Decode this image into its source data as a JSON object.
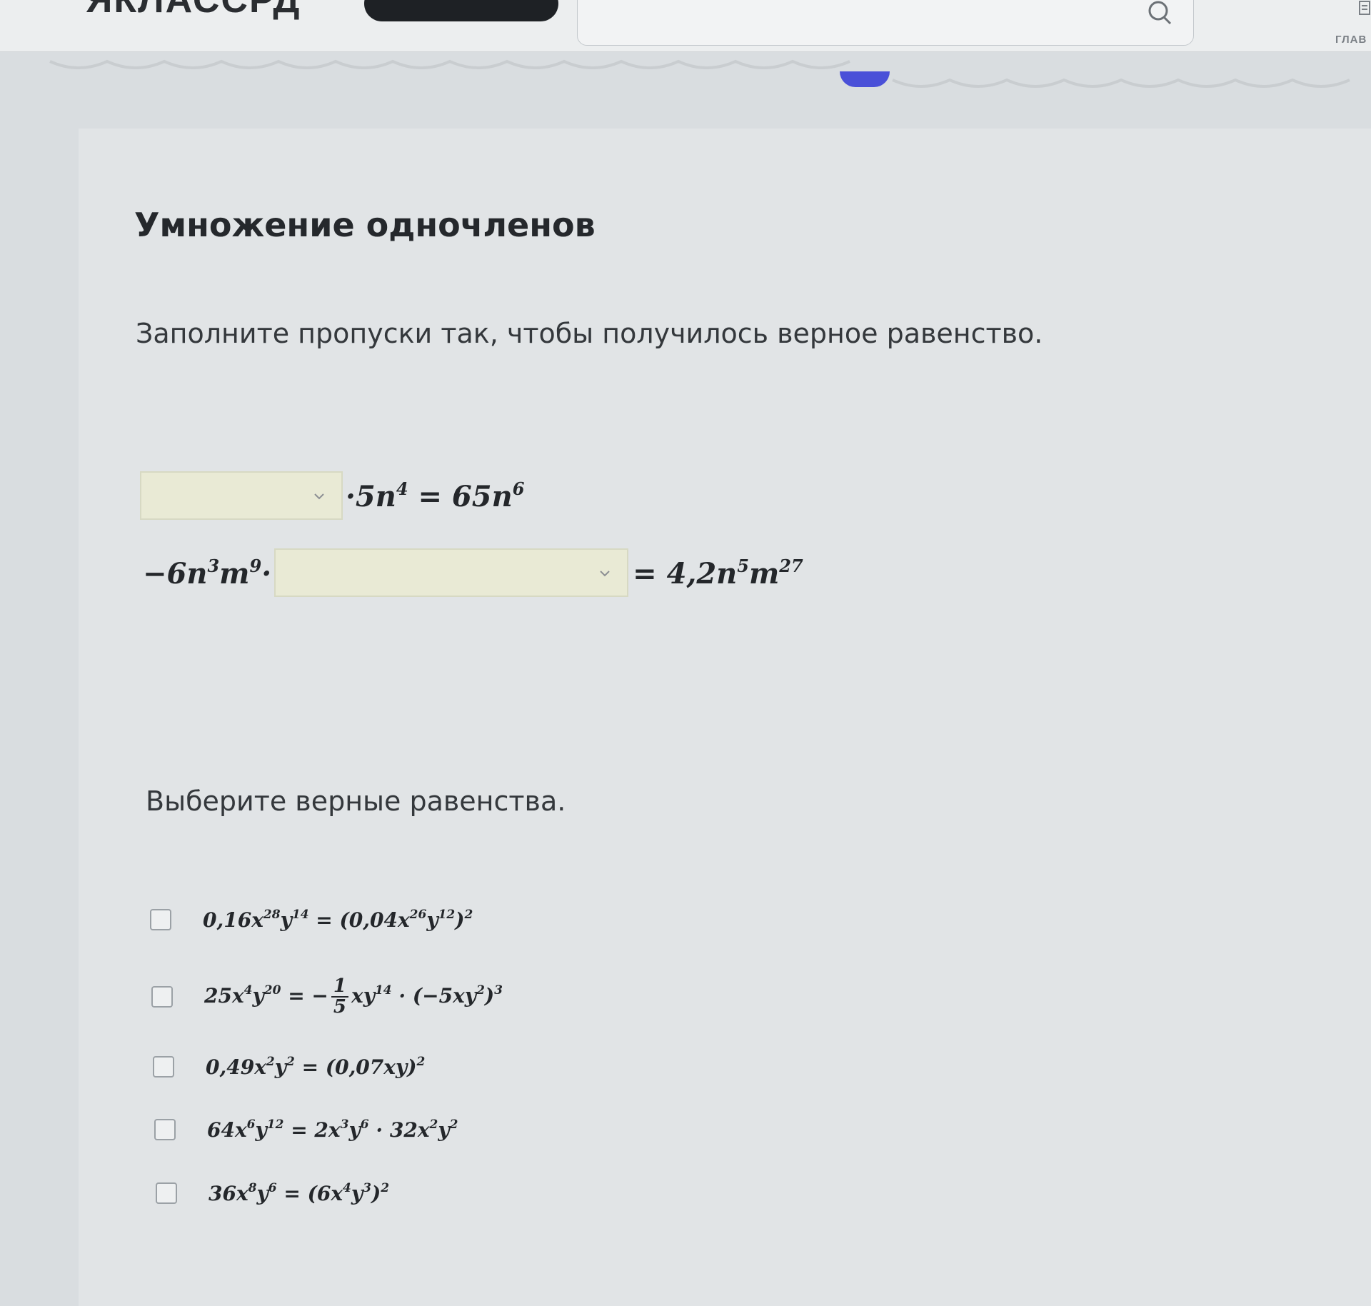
{
  "header": {
    "logo_text": "ЯКЛАССРД",
    "side_label": "ГЛАВ"
  },
  "lesson": {
    "title": "Умножение одночленов"
  },
  "task1": {
    "instruction": "Заполните пропуски так, чтобы получилось верное равенство.",
    "eq1": {
      "dropdown_value": "",
      "after": [
        "·5",
        "n",
        "4",
        " = 65",
        "n",
        "6"
      ]
    },
    "eq2": {
      "before": [
        "−6",
        "n",
        "3",
        "m",
        "9",
        "·"
      ],
      "dropdown_value": "",
      "after": [
        "= 4,2",
        "n",
        "5",
        "m",
        "27"
      ]
    }
  },
  "task2": {
    "instruction": "Выберите верные равенства.",
    "options": [
      {
        "checked": false,
        "parts": [
          "0,16",
          "x",
          "28",
          "y",
          "14",
          " = (0,04",
          "x",
          "26",
          "y",
          "12",
          ")",
          "2"
        ]
      },
      {
        "checked": false,
        "lhs": [
          "25",
          "x",
          "4",
          "y",
          "20",
          " = −"
        ],
        "frac_num": "1",
        "frac_den": "5",
        "rhs": [
          "x",
          "y",
          "14",
          " · (−5",
          "x",
          "y",
          "2",
          ")",
          "3"
        ]
      },
      {
        "checked": false,
        "parts": [
          "0,49",
          "x",
          "2",
          "y",
          "2",
          " = (0,07",
          "x",
          "y",
          ")",
          "2"
        ]
      },
      {
        "checked": false,
        "parts": [
          "64",
          "x",
          "6",
          "y",
          "12",
          " = 2",
          "x",
          "3",
          "y",
          "6",
          " · 32",
          "x",
          "2",
          "y",
          "2"
        ]
      },
      {
        "checked": false,
        "parts": [
          "36",
          "x",
          "8",
          "y",
          "6",
          " = (6",
          "x",
          "4",
          "y",
          "3",
          ")",
          "2"
        ]
      }
    ]
  },
  "colors": {
    "accent_progress": "#4a50d8",
    "dropdown_fill": "#e9ead5"
  },
  "icons": [
    "search-icon",
    "chevron-down-icon",
    "menu-icon"
  ]
}
